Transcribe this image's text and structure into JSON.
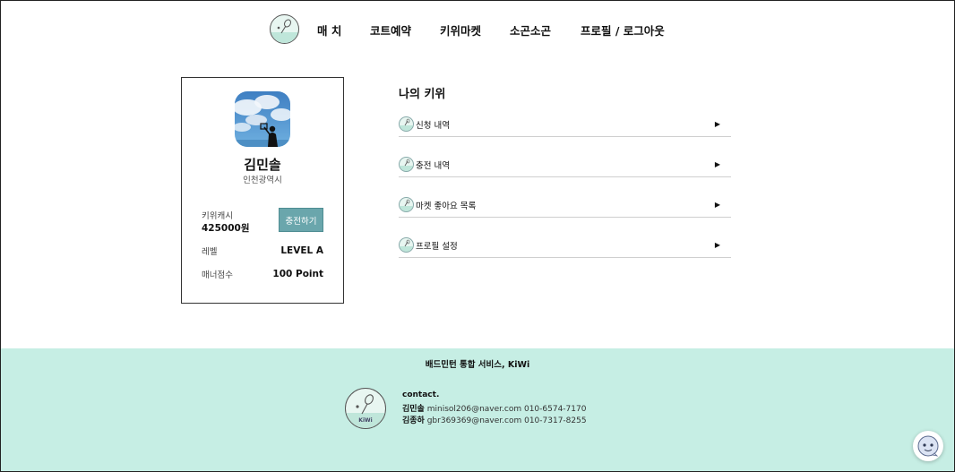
{
  "header": {
    "logo_alt": "KiWi",
    "nav": [
      {
        "label": "매 치"
      },
      {
        "label": "코트예약"
      },
      {
        "label": "키위마켓"
      },
      {
        "label": "소곤소곤"
      },
      {
        "label": "프로필 / 로그아웃"
      }
    ]
  },
  "profile": {
    "name": "김민솔",
    "region": "인천광역시",
    "cash_label": "키위캐시",
    "cash_value": "425000원",
    "charge_button": "충전하기",
    "level_label": "레벨",
    "level_value": "LEVEL A",
    "manner_label": "매너점수",
    "manner_value": "100 Point"
  },
  "my_kiwi": {
    "title": "나의 키위",
    "items": [
      {
        "label": "신청 내역"
      },
      {
        "label": "충전 내역"
      },
      {
        "label": "마켓 좋아요 목록"
      },
      {
        "label": "프로필 설정"
      }
    ],
    "arrow": "▶"
  },
  "footer": {
    "title": "배드민턴 통합 서비스, KiWi",
    "logo_text": "KiWi",
    "contact_head": "contact.",
    "contacts": [
      {
        "name": "김민솔",
        "info": "minisol206@naver.com 010-6574-7170"
      },
      {
        "name": "김종하",
        "info": "gbr369369@naver.com 010-7317-8255"
      }
    ]
  },
  "colors": {
    "footer_bg": "#c6eee4",
    "button_bg": "#6aa6ac",
    "logo_bg": "#e8f6f1"
  }
}
